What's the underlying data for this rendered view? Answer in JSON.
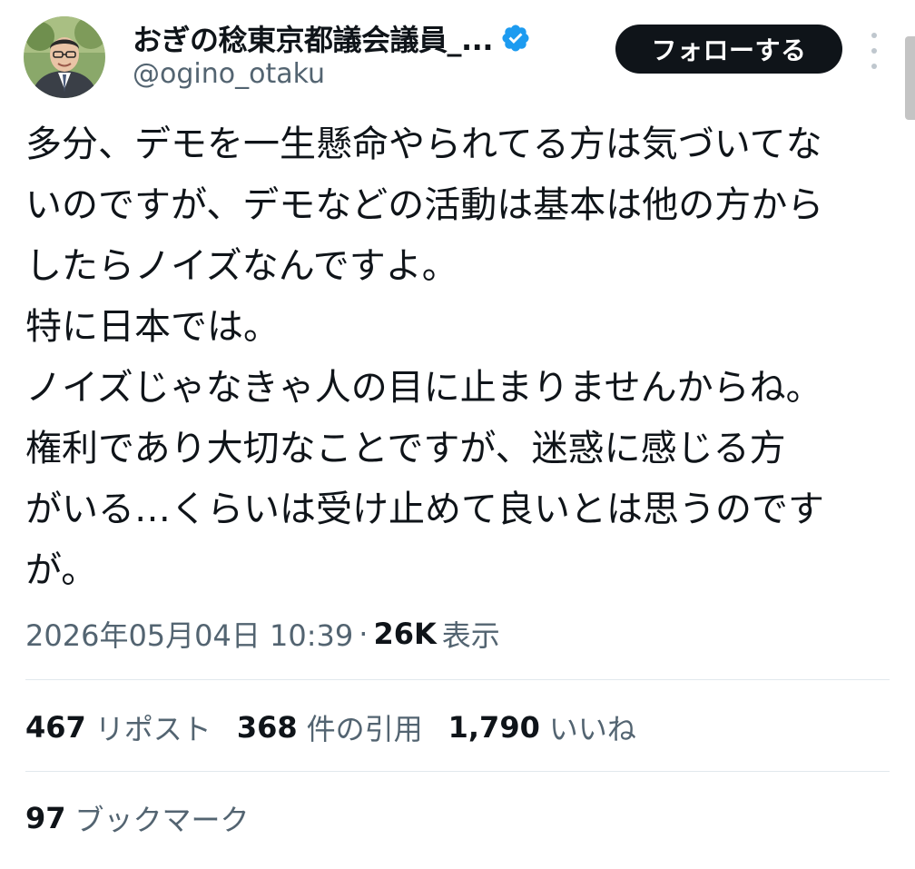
{
  "author": {
    "display_name": "おぎの稔東京都議会議員_...",
    "handle": "@ogino_otaku",
    "verified": true,
    "verified_color": "#1d9bf0"
  },
  "actions": {
    "follow_label": "フォローする",
    "more_icon": "more-vertical-icon"
  },
  "tweet": {
    "lines": [
      "多分、デモを一生懸命やられてる方は気づいてな",
      "いのですが、デモなどの活動は基本は他の方から",
      "したらノイズなんですよ。",
      "特に日本では。",
      "ノイズじゃなきゃ人の目に止まりませんからね。",
      "権利であり大切なことですが、迷惑に感じる方",
      "がいる…くらいは受け止めて良いとは思うのです",
      "が。"
    ],
    "timestamp": "2026年05月04日 10:39",
    "separator": "·",
    "views_count": "26K",
    "views_label": "表示"
  },
  "stats": {
    "reposts": {
      "count": "467",
      "label": "リポスト"
    },
    "quotes": {
      "count": "368",
      "label": "件の引用"
    },
    "likes": {
      "count": "1,790",
      "label": "いいね"
    },
    "bookmarks": {
      "count": "97",
      "label": "ブックマーク"
    }
  },
  "colors": {
    "text_primary": "#0f1419",
    "text_secondary": "#536471",
    "button_bg": "#0f1419",
    "divider": "#e1e8ed"
  }
}
